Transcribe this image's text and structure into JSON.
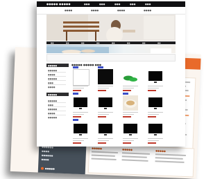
{
  "front_page": {
    "brand": "●●●●● ●●●●●",
    "top_nav": [
      "●●●",
      "●●●",
      "●●●",
      "●●●",
      "●●●"
    ],
    "sub_nav": [
      "●●●●",
      "●●●●",
      "●●●●",
      "●●●●"
    ],
    "category_strip": [
      "●●",
      "●●",
      "●●",
      "●●",
      "●●",
      "●●",
      "●●",
      "●●"
    ],
    "main_title": "●●●●● ●●●●● ●●●",
    "sidebar_headings": [
      "●●●●●",
      "●●●●●"
    ],
    "sidebar_items": [
      "●●●●●",
      "●●●●",
      "●●●●●",
      "●●●",
      "●●●●",
      "●●●●●",
      "●●●",
      "●●●●●",
      "●●●●",
      "●●●●●"
    ],
    "products": [
      {
        "image": "blank-screen",
        "badge": true
      },
      {
        "image": "black-monitor",
        "badge": true
      },
      {
        "image": "green-shoes",
        "badge": false
      },
      {
        "image": "black-tv",
        "badge": false
      },
      {
        "image": "black-tv",
        "badge": true
      },
      {
        "image": "black-tv",
        "badge": false
      },
      {
        "image": "food-dish",
        "badge": true
      },
      {
        "image": "black-tv",
        "badge": false
      },
      {
        "image": "black-tv",
        "badge": true
      },
      {
        "image": "black-tv",
        "badge": false
      },
      {
        "image": "black-tv",
        "badge": false
      },
      {
        "image": "black-tv",
        "badge": false
      }
    ]
  },
  "back_page": {
    "left_nav_items": [
      "●●●●●",
      "●●●●●●",
      "●●●●",
      "●●●●●●",
      "●●●●"
    ],
    "column_heads": [
      "●●●●●",
      "●●●●●",
      "●●●●●"
    ],
    "logo_text": "●●●●●"
  },
  "colors": {
    "accent_orange": "#e96a2a",
    "dark_bar": "#101012",
    "badge_blue": "#3a4ec7",
    "nav_gray": "#46505a"
  }
}
